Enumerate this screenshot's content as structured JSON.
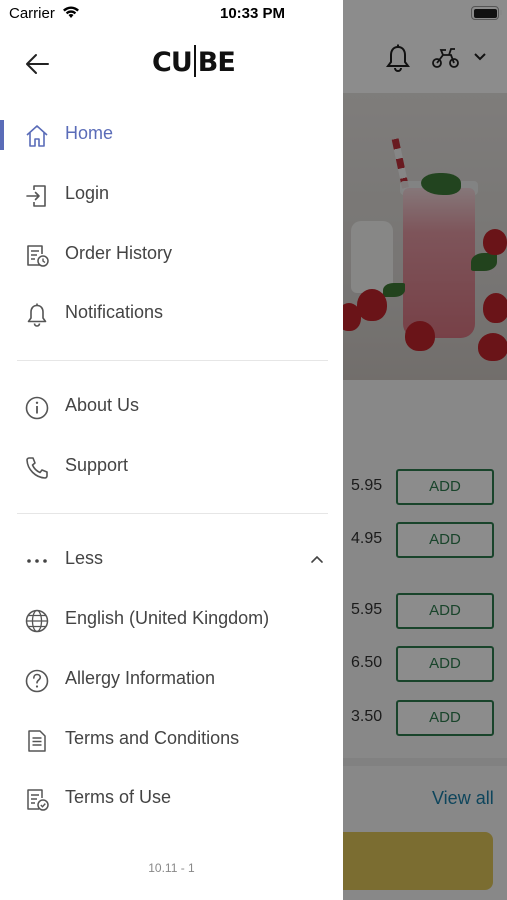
{
  "status_bar": {
    "carrier": "Carrier",
    "time": "10:33 PM"
  },
  "drawer": {
    "logo": {
      "left": "CU",
      "right": "BE"
    },
    "primary_items": [
      {
        "label": "Home",
        "icon": "home-icon",
        "active": true
      },
      {
        "label": "Login",
        "icon": "login-icon"
      },
      {
        "label": "Order History",
        "icon": "order-history-icon"
      },
      {
        "label": "Notifications",
        "icon": "bell-icon"
      }
    ],
    "secondary_items": [
      {
        "label": "About Us",
        "icon": "info-icon"
      },
      {
        "label": "Support",
        "icon": "phone-icon"
      }
    ],
    "less_toggle": {
      "label": "Less",
      "icon": "more-dots-icon"
    },
    "more_items": [
      {
        "label": "English (United Kingdom)",
        "icon": "globe-icon"
      },
      {
        "label": "Allergy Information",
        "icon": "question-icon"
      },
      {
        "label": "Terms and Conditions",
        "icon": "document-icon"
      },
      {
        "label": "Terms of Use",
        "icon": "document-check-icon"
      }
    ],
    "version": "10.11 - 1"
  },
  "background": {
    "items": [
      {
        "price": "5.95",
        "add_label": "ADD"
      },
      {
        "price": "4.95",
        "add_label": "ADD"
      },
      {
        "price": "5.95",
        "add_label": "ADD"
      },
      {
        "price": "6.50",
        "add_label": "ADD"
      },
      {
        "price": "3.50",
        "add_label": "ADD"
      }
    ],
    "view_all": "View all"
  },
  "colors": {
    "accent": "#5a6cb8",
    "add_button": "#2e7d4f",
    "view_all": "#1a7fa8",
    "cta": "#e0c659"
  }
}
